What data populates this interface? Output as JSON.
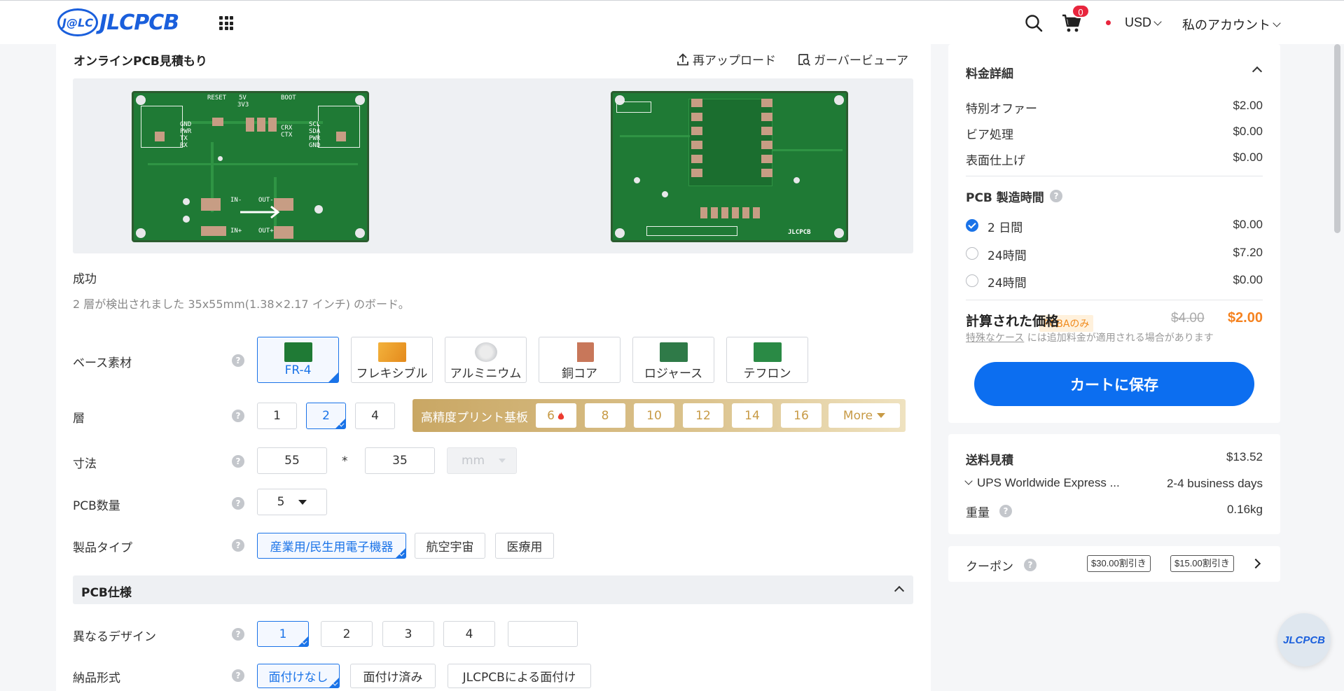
{
  "header": {
    "logo_badge": "J@LC",
    "logo_text": "JLCPCB",
    "cart_count": "0",
    "currency": "USD",
    "account": "私のアカウント"
  },
  "main": {
    "title": "オンラインPCB見積もり",
    "reupload": "再アップロード",
    "gerber_viewer": "ガーバービューア",
    "status": "成功",
    "detected": "2 層が検出されました 35x55mm(1.38×2.17 インチ) のボード。",
    "pcb_labels": {
      "reset": "RESET",
      "v5": "5V",
      "v33": "3V3",
      "boot": "BOOT",
      "gnd": "GND",
      "pwr": "PWR",
      "tx": "TX",
      "rx": "RX",
      "crx": "CRX",
      "ctx": "CTX",
      "scl": "SCL",
      "sda": "SDA",
      "in_minus": "IN-",
      "in_plus": "IN+",
      "out_minus": "OUT-",
      "out_plus": "OUT+",
      "back_logo": "JLCPCB"
    }
  },
  "base_material": {
    "label": "ベース素材",
    "options": [
      "FR-4",
      "フレキシブル",
      "アルミニウム",
      "銅コア",
      "ロジャース",
      "テフロン"
    ]
  },
  "layers": {
    "label": "層",
    "options": [
      "1",
      "2",
      "4"
    ],
    "hp_label": "高精度プリント基板",
    "hp_options": [
      "6",
      "8",
      "10",
      "12",
      "14",
      "16"
    ],
    "more": "More"
  },
  "dimensions": {
    "label": "寸法",
    "width": "55",
    "sep": "*",
    "height": "35",
    "unit": "mm"
  },
  "quantity": {
    "label": "PCB数量",
    "value": "5"
  },
  "product_type": {
    "label": "製品タイプ",
    "options": [
      "産業用/民生用電子機器",
      "航空宇宙",
      "医療用"
    ]
  },
  "spec": {
    "title": "PCB仕様"
  },
  "designs": {
    "label": "異なるデザイン",
    "options": [
      "1",
      "2",
      "3",
      "4"
    ]
  },
  "delivery": {
    "label": "納品形式",
    "options": [
      "面付けなし",
      "面付け済み",
      "JLCPCBによる面付け"
    ]
  },
  "help_glyph": "?",
  "price": {
    "title": "料金詳細",
    "rows": [
      {
        "k": "特別オファー",
        "v": "$2.00"
      },
      {
        "k": "ビア処理",
        "v": "$0.00"
      },
      {
        "k": "表面仕上げ",
        "v": "$0.00"
      }
    ],
    "build_time_title": "PCB 製造時間",
    "build_options": [
      {
        "k": "2 日間",
        "v": "$0.00"
      },
      {
        "k": "24時間",
        "v": "$7.20"
      },
      {
        "k": "24時間",
        "v": "$0.00"
      }
    ],
    "pcba_tag": "PCBAのみ",
    "calc_title": "計算された価格",
    "old_price": "$4.00",
    "new_price": "$2.00",
    "special_link": "特殊なケース",
    "special_note": " には追加料金が適用される場合があります",
    "save_button": "カートに保存"
  },
  "shipping": {
    "title": "送料見積",
    "cost": "$13.52",
    "method": "UPS Worldwide Express ...",
    "days": "2-4 business days",
    "weight_label": "重量",
    "weight": "0.16kg"
  },
  "coupon": {
    "label": "クーポン",
    "tags": [
      "$30.00割引き",
      "$15.00割引き"
    ]
  },
  "float_logo": "JLCPCB"
}
